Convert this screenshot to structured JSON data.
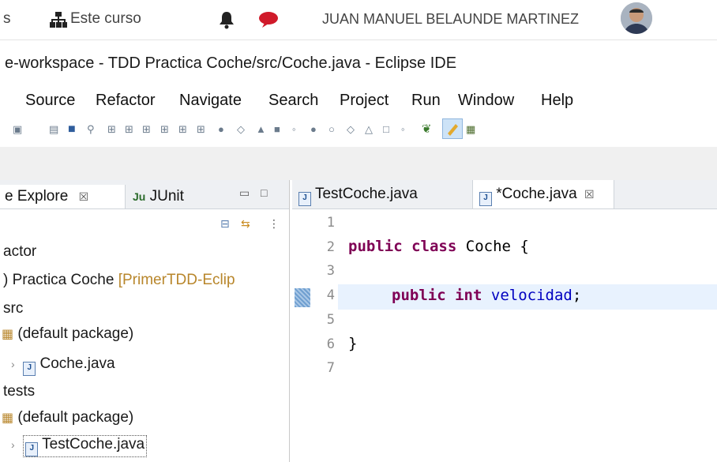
{
  "topbar": {
    "left_fragment": "s",
    "course_link": "Este curso",
    "user_name": "JUAN MANUEL BELAUNDE MARTINEZ"
  },
  "window_title": "e-workspace - TDD Practica Coche/src/Coche.java - Eclipse IDE",
  "menu": [
    "Source",
    "Refactor",
    "Navigate",
    "Search",
    "Project",
    "Run",
    "Window",
    "Help"
  ],
  "left_panel": {
    "tab_explorer": "e Explore",
    "tab_junit": "JUnit",
    "tab_close": "☒",
    "tree": [
      {
        "label": "actor"
      },
      {
        "label": ") Practica Coche",
        "suffix": "[PrimerTDD-Eclip"
      },
      {
        "label": "src"
      },
      {
        "label": "(default package)"
      },
      {
        "label": "Coche.java"
      },
      {
        "label": "tests"
      },
      {
        "label": "(default package)"
      },
      {
        "label": "TestCoche.java"
      }
    ]
  },
  "editor": {
    "tabs": [
      {
        "label": "TestCoche.java"
      },
      {
        "label": "*Coche.java"
      }
    ],
    "tab_close": "☒",
    "line_numbers": [
      "1",
      "2",
      "3",
      "4",
      "5",
      "6",
      "7"
    ],
    "code": {
      "line2_kw1": "public",
      "line2_kw2": "class",
      "line2_rest": "Coche {",
      "line4_kw1": "public",
      "line4_kw2": "int",
      "line4_field": "velocidad",
      "line4_end": ";",
      "line6": "}"
    }
  },
  "colors": {
    "keyword": "#7f0055",
    "field": "#0000c0",
    "chat_icon": "#d01a2a"
  }
}
